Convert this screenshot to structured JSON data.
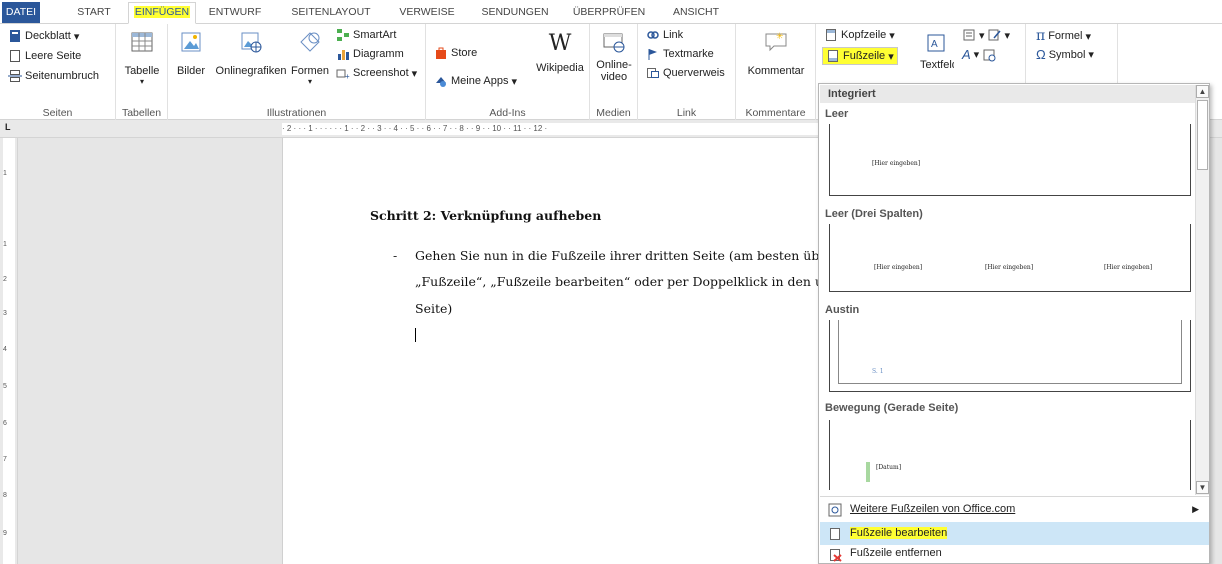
{
  "tabs": {
    "file": "DATEI",
    "items": [
      "START",
      "EINFÜGEN",
      "ENTWURF",
      "SEITENLAYOUT",
      "VERWEISE",
      "SENDUNGEN",
      "ÜBERPRÜFEN",
      "ANSICHT"
    ],
    "active": "EINFÜGEN"
  },
  "ribbon": {
    "seiten": {
      "label": "Seiten",
      "deckblatt": "Deckblatt",
      "leere_seite": "Leere Seite",
      "seitenumbruch": "Seitenumbruch"
    },
    "tabellen": {
      "label": "Tabellen",
      "tabelle": "Tabelle"
    },
    "illustrationen": {
      "label": "Illustrationen",
      "bilder": "Bilder",
      "onlinegrafiken": "Onlinegrafiken",
      "formen": "Formen",
      "smartart": "SmartArt",
      "diagramm": "Diagramm",
      "screenshot": "Screenshot"
    },
    "addins": {
      "label": "Add-Ins",
      "store": "Store",
      "meine_apps": "Meine Apps",
      "wikipedia": "Wikipedia"
    },
    "medien": {
      "label": "Medien",
      "online_video_1": "Online-",
      "online_video_2": "video"
    },
    "link": {
      "label": "Link",
      "link": "Link",
      "textmarke": "Textmarke",
      "querverweis": "Querverweis"
    },
    "kommentare": {
      "label": "Kommentare",
      "kommentar": "Kommentar"
    },
    "kopf": {
      "kopfzeile": "Kopfzeile",
      "fusszeile": "Fußzeile",
      "textfeld": "Textfeld"
    },
    "symbole": {
      "formel": "Formel",
      "symbol": "Symbol"
    }
  },
  "ruler": {
    "h": "· 2 · · · 1 · · · · · · 1 · · 2 · · 3 · · 4 · · 5 · · 6 · · 7 · · 8 · · 9 · · 10 · · 11 · · 12 ·",
    "v": [
      "1",
      "1",
      "2",
      "3",
      "4",
      "5",
      "6",
      "7",
      "8",
      "9"
    ]
  },
  "document": {
    "heading": "Schritt 2: Verknüpfung aufheben",
    "bullet": "-",
    "lines": [
      "Gehen Sie nun in die Fußzeile ihrer dritten Seite (am besten üb",
      "„Fußzeile“, „Fußzeile bearbeiten“ oder per Doppelklick in den u",
      "Seite)"
    ]
  },
  "gallery": {
    "header": "Integriert",
    "sections": [
      {
        "title": "Leer",
        "placeholders": [
          "[Hier eingeben]"
        ]
      },
      {
        "title": "Leer (Drei Spalten)",
        "placeholders": [
          "[Hier eingeben]",
          "[Hier eingeben]",
          "[Hier eingeben]"
        ]
      },
      {
        "title": "Austin",
        "placeholders": [
          "S. 1"
        ]
      },
      {
        "title": "Bewegung (Gerade Seite)",
        "placeholders": [
          "[Datum]"
        ]
      }
    ],
    "menu": {
      "weitere": "Weitere Fußzeilen von Office.com",
      "bearbeiten": "Fußzeile bearbeiten",
      "entfernen": "Fußzeile entfernen"
    }
  },
  "colors": {
    "accent": "#2b579a",
    "highlight": "#ffff33",
    "selection": "#cde6f7"
  }
}
